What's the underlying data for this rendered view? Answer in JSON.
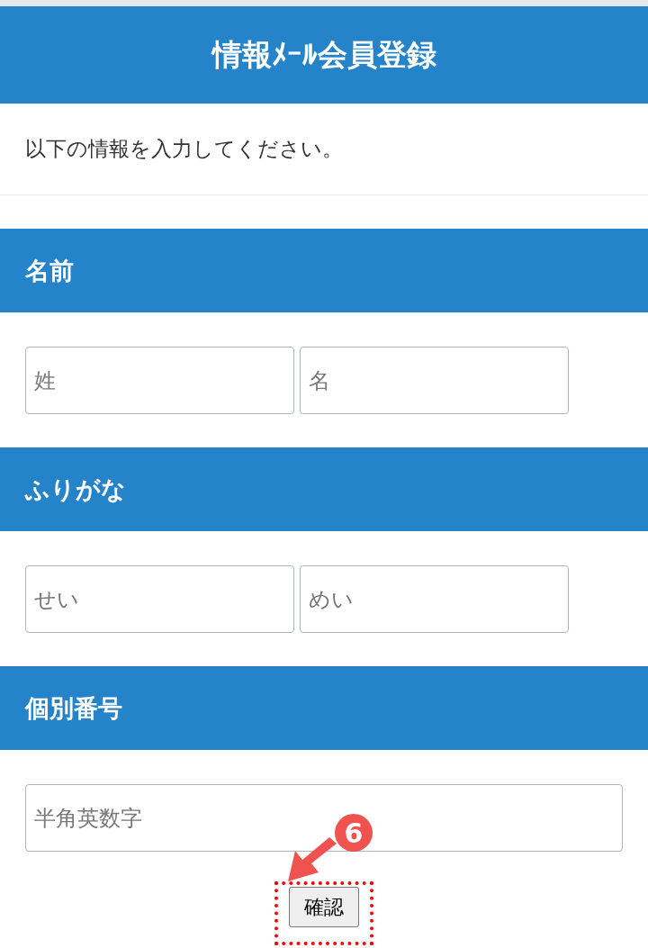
{
  "header": {
    "title": "情報ﾒｰﾙ会員登録"
  },
  "intro": "以下の情報を入力してください。",
  "sections": [
    {
      "title": "名前",
      "fields": [
        {
          "placeholder": "姓"
        },
        {
          "placeholder": "名"
        }
      ]
    },
    {
      "title": "ふりがな",
      "fields": [
        {
          "placeholder": "せい"
        },
        {
          "placeholder": "めい"
        }
      ]
    },
    {
      "title": "個別番号",
      "fields": [
        {
          "placeholder": "半角英数字"
        }
      ]
    }
  ],
  "submit_button": "確認",
  "annotation": {
    "badge": "6"
  }
}
